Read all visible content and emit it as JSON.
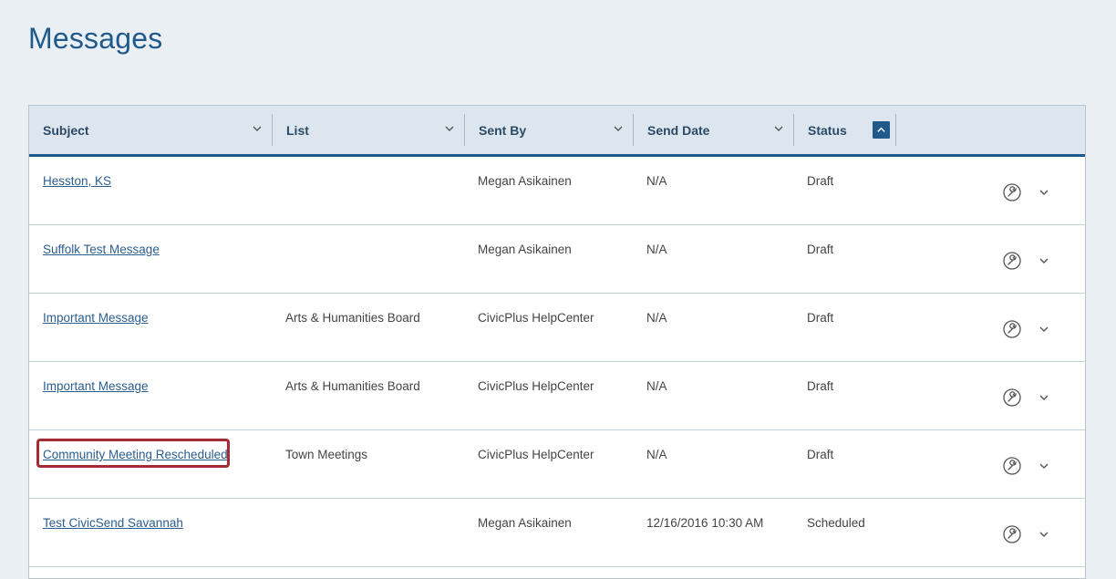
{
  "page": {
    "title": "Messages"
  },
  "table": {
    "columns": [
      {
        "key": "subject",
        "label": "Subject"
      },
      {
        "key": "list",
        "label": "List"
      },
      {
        "key": "sent_by",
        "label": "Sent By"
      },
      {
        "key": "send_date",
        "label": "Send Date"
      },
      {
        "key": "status",
        "label": "Status"
      }
    ],
    "sort": {
      "column": "status",
      "direction": "ascending"
    },
    "rows": [
      {
        "subject": "Hesston, KS",
        "list": "",
        "sent_by": "Megan Asikainen",
        "send_date": "N/A",
        "status": "Draft"
      },
      {
        "subject": "Suffolk Test Message",
        "list": "",
        "sent_by": "Megan Asikainen",
        "send_date": "N/A",
        "status": "Draft"
      },
      {
        "subject": "Important Message",
        "list": "Arts & Humanities Board",
        "sent_by": "CivicPlus HelpCenter",
        "send_date": "N/A",
        "status": "Draft"
      },
      {
        "subject": "Important Message",
        "list": "Arts & Humanities Board",
        "sent_by": "CivicPlus HelpCenter",
        "send_date": "N/A",
        "status": "Draft"
      },
      {
        "subject": "Community Meeting Rescheduled",
        "list": "Town Meetings",
        "sent_by": "CivicPlus HelpCenter",
        "send_date": "N/A",
        "status": "Draft",
        "highlighted": true
      },
      {
        "subject": "Test CivicSend Savannah",
        "list": "",
        "sent_by": "Megan Asikainen",
        "send_date": "12/16/2016 10:30 AM",
        "status": "Scheduled"
      }
    ]
  },
  "icons": {
    "column_menu": "chevron-down-icon",
    "sort": "chevron-up-icon",
    "row_action": "wrench-circle-icon",
    "row_expand": "chevron-down-icon"
  },
  "colors": {
    "title": "#205a8c",
    "header_bg": "#dde6ef",
    "header_border": "#1f5a8a",
    "link": "#2b5d8f",
    "highlight": "#a52a35"
  }
}
